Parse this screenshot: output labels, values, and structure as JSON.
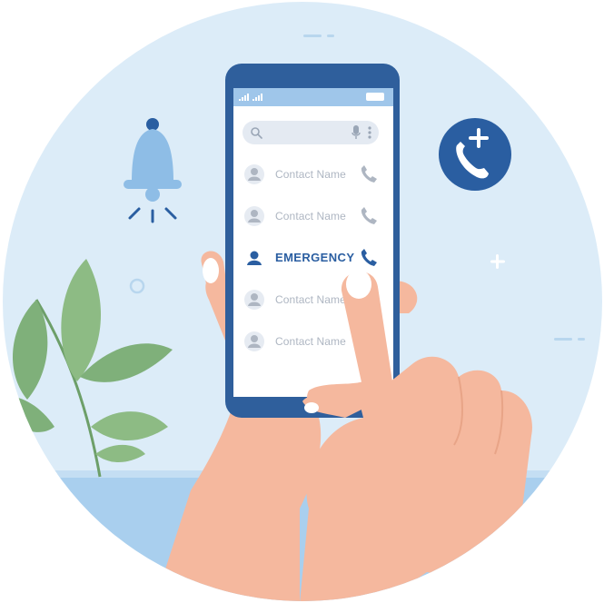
{
  "screen": {
    "search": {
      "search_icon": "search-icon",
      "mic_icon": "mic-icon",
      "more_icon": "more-vertical-icon"
    },
    "contacts": [
      {
        "name": "Contact Name",
        "highlighted": false
      },
      {
        "name": "Contact Name",
        "highlighted": false
      },
      {
        "name": "EMERGENCY",
        "highlighted": true
      },
      {
        "name": "Contact Name",
        "highlighted": false
      },
      {
        "name": "Contact Name",
        "highlighted": false
      }
    ]
  },
  "icons": {
    "bell": "bell-icon",
    "add_call": "add-call-icon",
    "plant": "plant-icon"
  },
  "colors": {
    "background_circle": "#dcecf8",
    "phone_body": "#2f5f9c",
    "accent": "#2a5ea1",
    "bell": "#8ebde6",
    "skin": "#f5b89e",
    "leaf": "#7fb07a",
    "table": "#a9cfee"
  }
}
